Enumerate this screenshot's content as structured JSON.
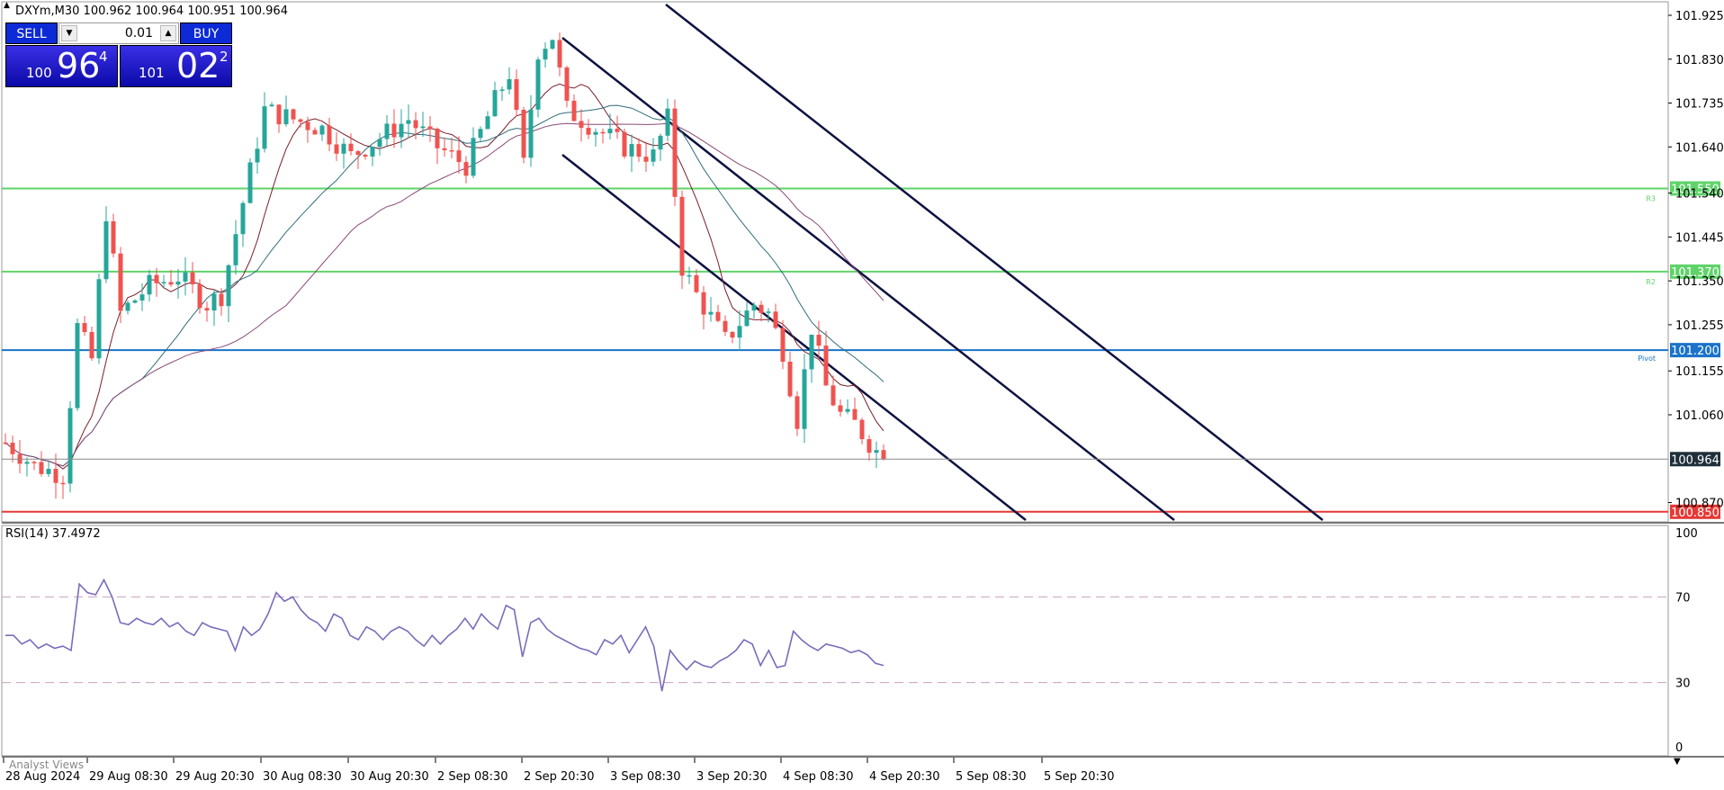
{
  "chart_header": {
    "title": "DXYm,M30 100.962 100.964 100.951 100.964"
  },
  "trade_panel": {
    "sell_label": "SELL",
    "buy_label": "BUY",
    "lot_value": "0.01",
    "sell_price_small": "100",
    "sell_price_big": "96",
    "sell_price_sup": "4",
    "buy_price_small": "101",
    "buy_price_big": "02",
    "buy_price_sup": "2"
  },
  "price_axis": {
    "ticks": [
      "101.925",
      "101.830",
      "101.735",
      "101.640",
      "101.540",
      "101.445",
      "101.350",
      "101.255",
      "101.155",
      "101.060",
      "100.870"
    ],
    "tick_values": [
      101.925,
      101.83,
      101.735,
      101.64,
      101.54,
      101.445,
      101.35,
      101.255,
      101.155,
      101.06,
      100.87
    ],
    "current_price": "100.964"
  },
  "levels": [
    {
      "label": "101.550",
      "value": 101.55,
      "color": "#5fd36a",
      "tag": "R3"
    },
    {
      "label": "101.370",
      "value": 101.37,
      "color": "#5fd36a",
      "tag": "R2"
    },
    {
      "label": "101.200",
      "value": 101.2,
      "color": "#1a73c8",
      "tag": "Pivot"
    },
    {
      "label": "100.850",
      "value": 100.85,
      "color": "#e53935",
      "tag": ""
    }
  ],
  "rsi": {
    "title": "RSI(14) 37.4972",
    "ticks": [
      "100",
      "70",
      "30",
      "0"
    ],
    "tick_values": [
      100,
      70,
      30,
      0
    ],
    "color": "#7a6bbd"
  },
  "time_axis": {
    "labels": [
      "28 Aug 2024",
      "29 Aug 08:30",
      "29 Aug 20:30",
      "30 Aug 08:30",
      "30 Aug 20:30",
      "2 Sep 08:30",
      "2 Sep 20:30",
      "3 Sep 08:30",
      "3 Sep 20:30",
      "4 Sep 08:30",
      "4 Sep 20:30",
      "5 Sep 08:30",
      "5 Sep 20:30"
    ]
  },
  "bottom_tab": {
    "label": "Analyst Views"
  },
  "colors": {
    "bull_candle": "#26a69a",
    "bear_candle": "#ef5350",
    "channel_line": "#0d1240",
    "ma_fast": "#7a1f2a",
    "ma_mid": "#2f6d7a",
    "ma_slow": "#8a4a78"
  },
  "chart_data": [
    {
      "type": "candlestick",
      "title": "DXYm,M30",
      "ylim": [
        100.85,
        101.96
      ],
      "x_labels": [
        "28 Aug 2024",
        "29 Aug 08:30",
        "29 Aug 20:30",
        "30 Aug 08:30",
        "30 Aug 20:30",
        "2 Sep 08:30",
        "2 Sep 20:30",
        "3 Sep 08:30",
        "3 Sep 20:30",
        "4 Sep 08:30",
        "4 Sep 20:30",
        "5 Sep 08:30",
        "5 Sep 20:30"
      ],
      "close_path": [
        [
          0,
          101.0
        ],
        [
          4,
          100.95
        ],
        [
          8,
          100.93
        ],
        [
          10,
          101.25
        ],
        [
          12,
          101.18
        ],
        [
          14,
          101.5
        ],
        [
          16,
          101.28
        ],
        [
          20,
          101.34
        ],
        [
          24,
          101.36
        ],
        [
          28,
          101.3
        ],
        [
          30,
          101.32
        ],
        [
          33,
          101.52
        ],
        [
          36,
          101.72
        ],
        [
          40,
          101.7
        ],
        [
          44,
          101.68
        ],
        [
          48,
          101.62
        ],
        [
          52,
          101.66
        ],
        [
          56,
          101.7
        ],
        [
          60,
          101.64
        ],
        [
          64,
          101.6
        ],
        [
          68,
          101.74
        ],
        [
          70,
          101.8
        ],
        [
          72,
          101.6
        ],
        [
          74,
          101.85
        ],
        [
          76,
          101.88
        ],
        [
          78,
          101.72
        ],
        [
          82,
          101.68
        ],
        [
          86,
          101.64
        ],
        [
          90,
          101.62
        ],
        [
          92,
          101.7
        ],
        [
          94,
          101.38
        ],
        [
          96,
          101.32
        ],
        [
          100,
          101.22
        ],
        [
          104,
          101.3
        ],
        [
          106,
          101.28
        ],
        [
          108,
          101.2
        ],
        [
          110,
          101.05
        ],
        [
          112,
          101.25
        ],
        [
          114,
          101.12
        ],
        [
          116,
          101.06
        ],
        [
          118,
          101.04
        ],
        [
          120,
          101.0
        ],
        [
          122,
          100.964
        ]
      ],
      "levels": [
        101.55,
        101.37,
        101.2,
        100.85
      ],
      "current_price": 100.964
    },
    {
      "type": "line",
      "title": "RSI(14) 37.4972",
      "ylim": [
        0,
        100
      ],
      "reference_lines": [
        70,
        30
      ],
      "series": [
        {
          "values": [
            52,
            52,
            48,
            50,
            46,
            48,
            46,
            47,
            45,
            76,
            72,
            71,
            78,
            70,
            58,
            57,
            60,
            58,
            57,
            60,
            56,
            58,
            54,
            52,
            58,
            56,
            55,
            54,
            45,
            56,
            52,
            55,
            62,
            72,
            68,
            70,
            64,
            60,
            58,
            54,
            62,
            60,
            52,
            50,
            56,
            54,
            50,
            54,
            56,
            54,
            50,
            47,
            52,
            48,
            52,
            55,
            60,
            55,
            62,
            58,
            55,
            66,
            64,
            42,
            58,
            60,
            55,
            52,
            50,
            48,
            46,
            45,
            43,
            50,
            48,
            52,
            44,
            50,
            56,
            47,
            26,
            45,
            40,
            36,
            40,
            38,
            37,
            40,
            42,
            45,
            50,
            48,
            38,
            45,
            37,
            38,
            54,
            50,
            47,
            45,
            48,
            47,
            46,
            44,
            45,
            43,
            39,
            38
          ]
        }
      ]
    }
  ]
}
